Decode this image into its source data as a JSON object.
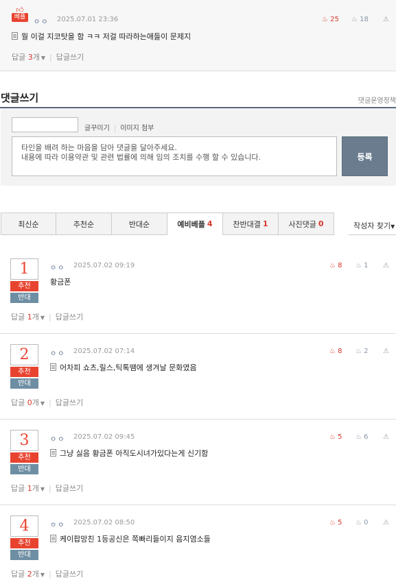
{
  "best_comment": {
    "badge": "베플",
    "nickname": "ㅇㅇ",
    "date": "2025.07.01 23:36",
    "up": "25",
    "down": "18",
    "text": "뭘 이걸 지코탓을 함 ㅋㅋ 저걸 따라하는애들이 문제지",
    "reply_prefix": "답글",
    "reply_count": "3",
    "reply_suffix": "개",
    "write_reply": "답글쓰기"
  },
  "write": {
    "title": "댓글쓰기",
    "policy": "댓글운영정책",
    "decorate": "글꾸미기",
    "attach_image": "이미지 첨부",
    "placeholder_line1": "타인을 배려 하는 마음을 담아 댓글을 달아주세요.",
    "placeholder_line2": "내용에 따라 이용약관 및 관련 법률에 의해 임의 조치를 수행 할 수 있습니다.",
    "submit": "등록"
  },
  "tabs": [
    {
      "label": "최신순",
      "count": ""
    },
    {
      "label": "추천순",
      "count": ""
    },
    {
      "label": "반대순",
      "count": ""
    },
    {
      "label": "예비베플",
      "count": "4"
    },
    {
      "label": "찬반대결",
      "count": "1"
    },
    {
      "label": "사진댓글",
      "count": "0"
    }
  ],
  "writer_find": "작성자 찾기",
  "vote_labels": {
    "up": "추천",
    "down": "반대"
  },
  "comments": [
    {
      "rank": "1",
      "nickname": "ㅇㅇ",
      "date": "2025.07.02 09:19",
      "up": "8",
      "down": "1",
      "text": "황금폰",
      "reply_count": "1"
    },
    {
      "rank": "2",
      "nickname": "ㅇㅇ",
      "date": "2025.07.02 07:14",
      "up": "8",
      "down": "2",
      "text": "어차피 쇼츠,릴스,틱톡땜에 생겨날 문화였음",
      "reply_count": "0"
    },
    {
      "rank": "3",
      "nickname": "ㅇㅇ",
      "date": "2025.07.02 09:45",
      "up": "5",
      "down": "6",
      "text": "그냥 싫음 황금폰 아직도시녀가있다는게 신기함",
      "reply_count": "1"
    },
    {
      "rank": "4",
      "nickname": "ㅇㅇ",
      "date": "2025.07.02 08:50",
      "up": "5",
      "down": "0",
      "text": "케이팝망친 1등공신은 쪽빠리들이지 음지염소들",
      "reply_count": "2"
    }
  ],
  "reply_prefix": "답글",
  "reply_suffix": "개",
  "write_reply": "답글쓰기"
}
